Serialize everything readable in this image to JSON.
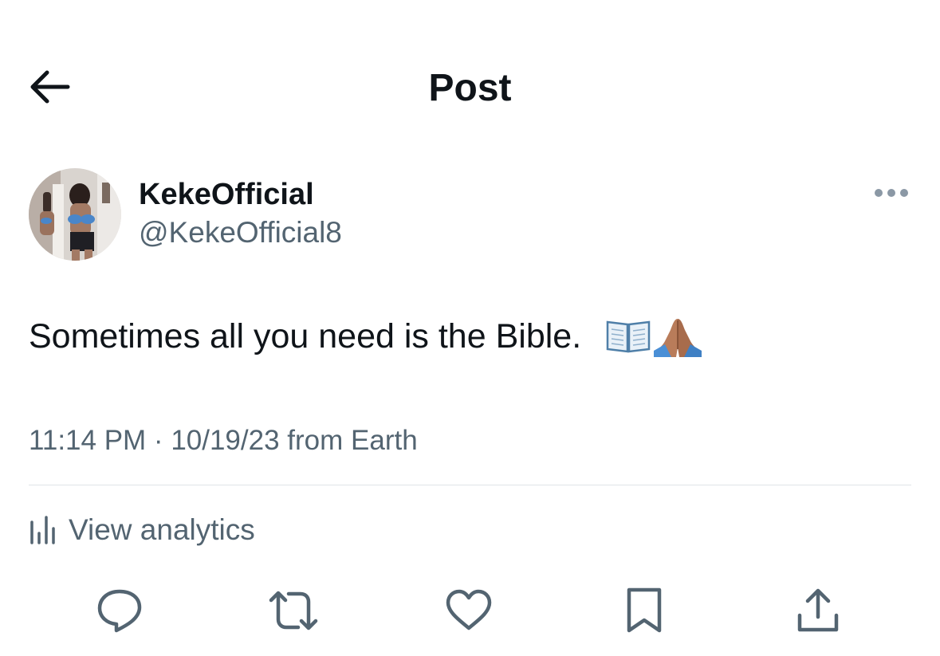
{
  "header": {
    "title": "Post",
    "back_icon": "arrow-left-icon"
  },
  "author": {
    "display_name": "KekeOfficial",
    "handle": "@KekeOfficial8",
    "more_icon": "more-horizontal-icon"
  },
  "post": {
    "text": "Sometimes all you need is the Bible.",
    "emojis": [
      "open-book-emoji",
      "folded-hands-emoji"
    ],
    "meta": "11:14 PM · 10/19/23 from Earth"
  },
  "analytics": {
    "label": "View analytics",
    "icon": "bar-chart-icon"
  },
  "actions": [
    {
      "name": "reply",
      "icon": "reply-bubble-icon"
    },
    {
      "name": "repost",
      "icon": "repost-icon"
    },
    {
      "name": "like",
      "icon": "heart-icon"
    },
    {
      "name": "bookmark",
      "icon": "bookmark-icon"
    },
    {
      "name": "share",
      "icon": "share-icon"
    }
  ],
  "colors": {
    "text_primary": "#0f1419",
    "text_secondary": "#536471",
    "divider": "#dfe4e8",
    "more_dots": "#8b98a5"
  }
}
